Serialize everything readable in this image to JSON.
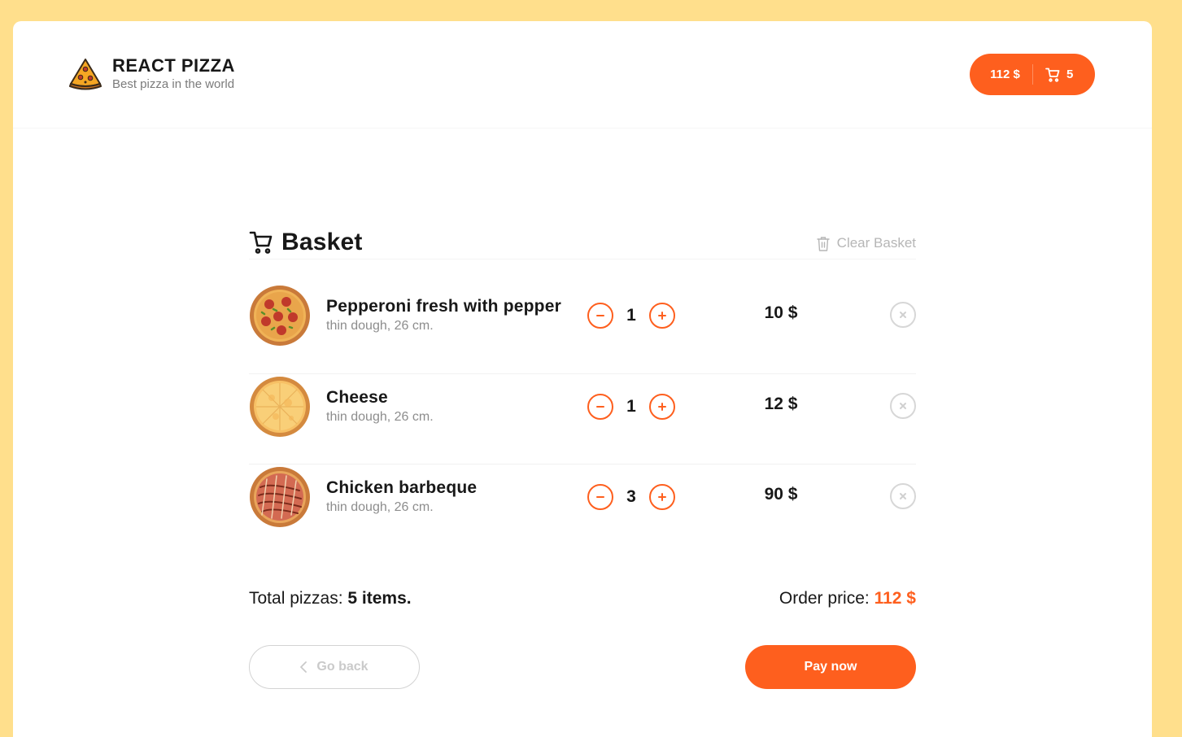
{
  "header": {
    "logo_title": "REACT PIZZA",
    "logo_subtitle": "Best pizza in the world",
    "cart_price": "112 $",
    "cart_count": "5"
  },
  "basket": {
    "title": "Basket",
    "clear_label": "Clear Basket",
    "items": [
      {
        "name": "Pepperoni fresh with pepper",
        "desc": "thin dough, 26 cm.",
        "qty": "1",
        "price": "10 $",
        "image": "pepperoni-pizza"
      },
      {
        "name": "Cheese",
        "desc": "thin dough, 26 cm.",
        "qty": "1",
        "price": "12 $",
        "image": "cheese-pizza"
      },
      {
        "name": "Chicken barbeque",
        "desc": "thin dough, 26 cm.",
        "qty": "3",
        "price": "90 $",
        "image": "bbq-pizza"
      }
    ],
    "total_label": "Total pizzas:",
    "total_value": "5 items.",
    "order_label": "Order price:",
    "order_value": "112 $",
    "back_label": "Go back",
    "pay_label": "Pay now"
  },
  "colors": {
    "background": "#ffdf8c",
    "accent": "#fe5f1e",
    "muted": "#b6b6b6"
  }
}
